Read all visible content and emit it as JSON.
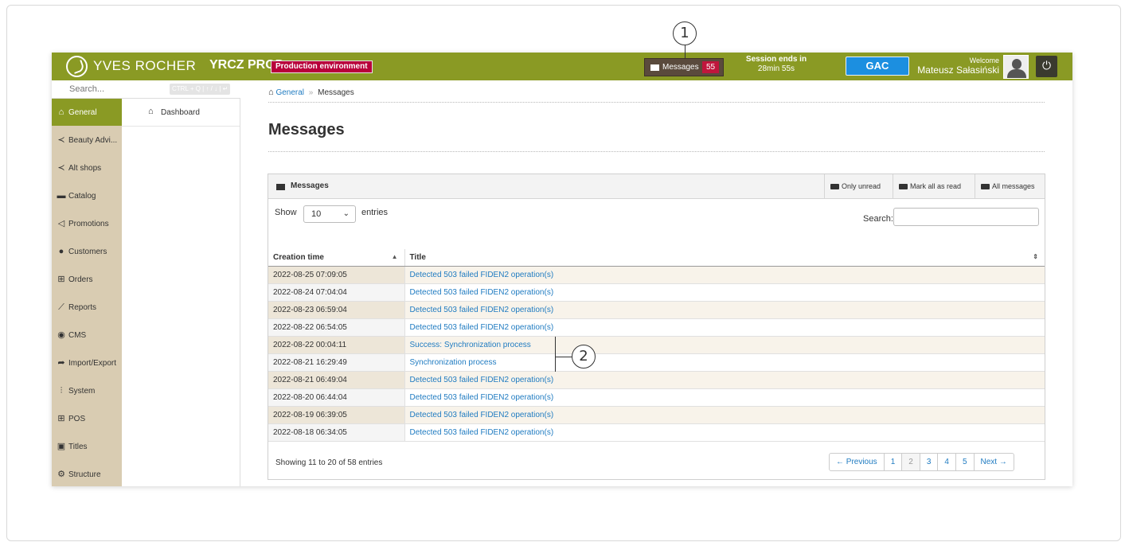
{
  "topbar": {
    "brand": "YVES ROCHER",
    "instance": "YRCZ PROD",
    "env_badge": "Production environment",
    "messages_label": "Messages",
    "messages_count": "55",
    "session_label": "Session ends in",
    "session_time": "28min 55s",
    "gac_label": "GAC",
    "welcome_label": "Welcome",
    "user_name": "Mateusz Sałasiński"
  },
  "sidebar": {
    "search_placeholder": "Search...",
    "shortcut": "CTRL + Q | ↑ / ↓ | ↵",
    "items": [
      {
        "label": "General",
        "icon": "home-icon"
      },
      {
        "label": "Beauty Advi...",
        "icon": "share-icon"
      },
      {
        "label": "Alt shops",
        "icon": "share-icon"
      },
      {
        "label": "Catalog",
        "icon": "folder-icon"
      },
      {
        "label": "Promotions",
        "icon": "megaphone-icon"
      },
      {
        "label": "Customers",
        "icon": "users-icon"
      },
      {
        "label": "Orders",
        "icon": "cart-icon"
      },
      {
        "label": "Reports",
        "icon": "chart-icon"
      },
      {
        "label": "CMS",
        "icon": "globe-icon"
      },
      {
        "label": "Import/Export",
        "icon": "arrow-icon"
      },
      {
        "label": "System",
        "icon": "sliders-icon"
      },
      {
        "label": "POS",
        "icon": "cart-icon"
      },
      {
        "label": "Titles",
        "icon": "card-icon"
      },
      {
        "label": "Structure",
        "icon": "sitemap-icon"
      }
    ],
    "subnav": {
      "label": "Dashboard",
      "icon": "home-icon"
    }
  },
  "breadcrumb": {
    "home": "General",
    "separator": "»",
    "current": "Messages"
  },
  "page_title": "Messages",
  "panel": {
    "title": "Messages",
    "btn_only_unread": "Only unread",
    "btn_mark_all": "Mark all as read",
    "btn_all_messages": "All messages",
    "show_label": "Show",
    "entries_value": "10",
    "entries_label": "entries",
    "search_label": "Search:"
  },
  "table": {
    "col_time": "Creation time",
    "col_title": "Title",
    "rows": [
      {
        "time": "2022-08-25 07:09:05",
        "title": "Detected 503 failed FIDEN2 operation(s)"
      },
      {
        "time": "2022-08-24 07:04:04",
        "title": "Detected 503 failed FIDEN2 operation(s)"
      },
      {
        "time": "2022-08-23 06:59:04",
        "title": "Detected 503 failed FIDEN2 operation(s)"
      },
      {
        "time": "2022-08-22 06:54:05",
        "title": "Detected 503 failed FIDEN2 operation(s)"
      },
      {
        "time": "2022-08-22 00:04:11",
        "title": "Success: Synchronization process"
      },
      {
        "time": "2022-08-21 16:29:49",
        "title": "Synchronization process"
      },
      {
        "time": "2022-08-21 06:49:04",
        "title": "Detected 503 failed FIDEN2 operation(s)"
      },
      {
        "time": "2022-08-20 06:44:04",
        "title": "Detected 503 failed FIDEN2 operation(s)"
      },
      {
        "time": "2022-08-19 06:39:05",
        "title": "Detected 503 failed FIDEN2 operation(s)"
      },
      {
        "time": "2022-08-18 06:34:05",
        "title": "Detected 503 failed FIDEN2 operation(s)"
      }
    ]
  },
  "footer": {
    "showing": "Showing 11 to 20 of 58 entries",
    "prev": "← Previous",
    "pages": [
      "1",
      "2",
      "3",
      "4",
      "5"
    ],
    "next": "Next →"
  },
  "callouts": {
    "one": "1",
    "two": "2"
  }
}
